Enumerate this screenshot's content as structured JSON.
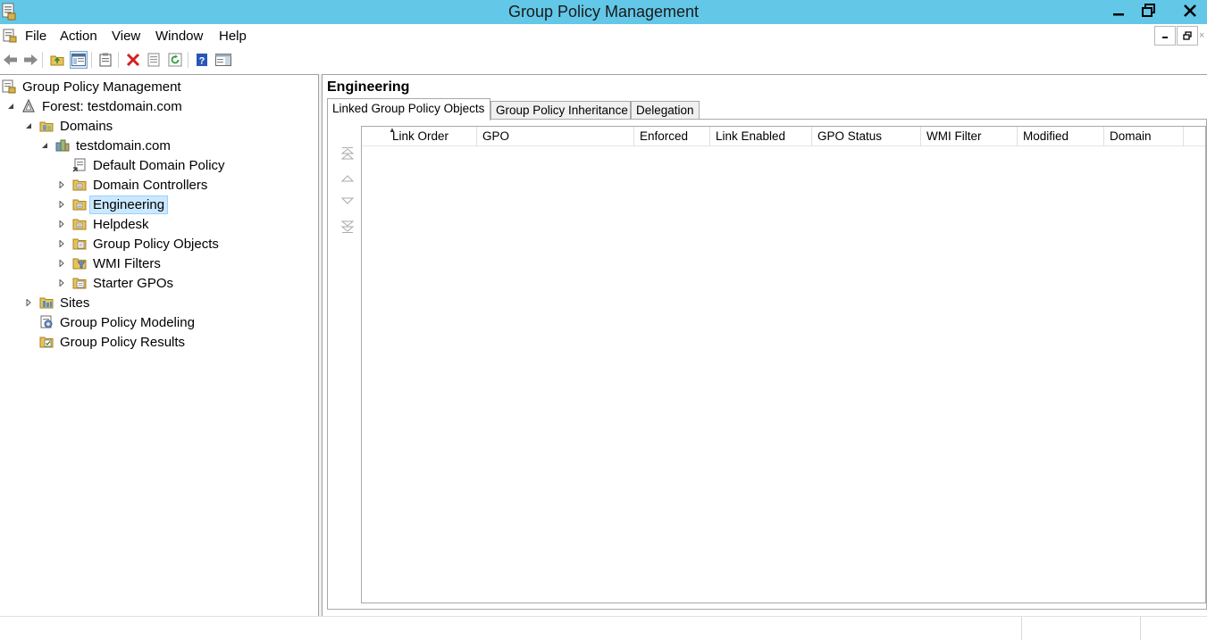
{
  "window": {
    "title": "Group Policy Management"
  },
  "menu": {
    "items": [
      "File",
      "Action",
      "View",
      "Window",
      "Help"
    ]
  },
  "toolbar": {
    "buttons": [
      {
        "icon": "back-arrow-icon"
      },
      {
        "icon": "forward-arrow-icon"
      },
      {
        "icon": "up-folder-icon"
      },
      {
        "icon": "show-hide-console-tree-icon"
      },
      {
        "icon": "clipboard-icon"
      },
      {
        "icon": "delete-icon"
      },
      {
        "icon": "properties-icon"
      },
      {
        "icon": "refresh-icon"
      },
      {
        "icon": "help-icon"
      },
      {
        "icon": "show-hide-action-pane-icon"
      }
    ]
  },
  "tree": {
    "items": [
      {
        "label": "Group Policy Management"
      },
      {
        "label": "Forest: testdomain.com"
      },
      {
        "label": "Domains"
      },
      {
        "label": "testdomain.com"
      },
      {
        "label": "Default Domain Policy"
      },
      {
        "label": "Domain Controllers"
      },
      {
        "label": "Engineering",
        "selected": true
      },
      {
        "label": "Helpdesk"
      },
      {
        "label": "Group Policy Objects"
      },
      {
        "label": "WMI Filters"
      },
      {
        "label": "Starter GPOs"
      },
      {
        "label": "Sites"
      },
      {
        "label": "Group Policy Modeling"
      },
      {
        "label": "Group Policy Results"
      }
    ]
  },
  "details": {
    "title": "Engineering",
    "tabs": [
      {
        "label": "Linked Group Policy Objects",
        "active": true
      },
      {
        "label": "Group Policy Inheritance"
      },
      {
        "label": "Delegation"
      }
    ],
    "columns": [
      "Link Order",
      "GPO",
      "Enforced",
      "Link Enabled",
      "GPO Status",
      "WMI Filter",
      "Modified",
      "Domain"
    ],
    "rows": []
  },
  "colors": {
    "titlebar": "#63c7e8",
    "selection": "#cce8ff",
    "folder": "#e8c35a"
  }
}
